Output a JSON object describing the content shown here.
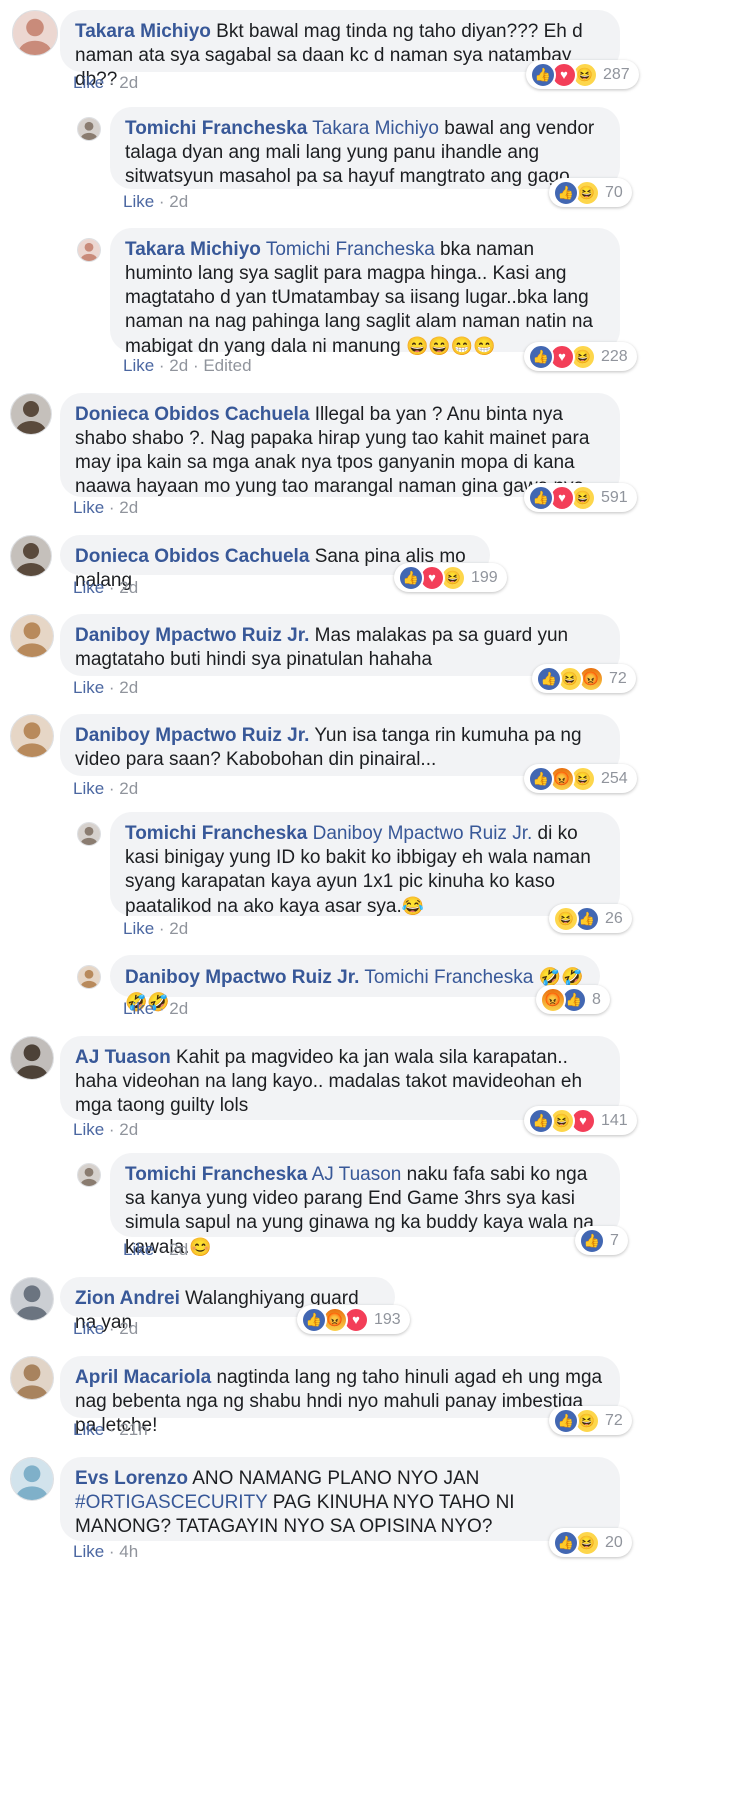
{
  "colors": {
    "link": "#385898",
    "bubble": "#f2f3f5",
    "meta": "#90949c",
    "like_reaction": "#4267b2",
    "love_reaction": "#f33e58",
    "haha_reaction": "#fdd64b"
  },
  "comments": [
    {
      "author": "Takara Michiyo",
      "text": "Bkt bawal mag tinda ng taho diyan??? Eh d naman ata sya sagabal sa daan kc d naman sya natambay db??",
      "like_label": "Like",
      "time": "2d",
      "reactions": [
        "like-icon",
        "love-icon",
        "haha-icon"
      ],
      "reaction_count": "287",
      "avatar_color": "#c98b7a"
    },
    {
      "author": "Tomichi Francheska",
      "mention": "Takara Michiyo",
      "text": "bawal ang vendor talaga dyan ang mali lang yung panu ihandle ang sitwatsyun masahol pa sa hayuf mangtrato ang gago.",
      "like_label": "Like",
      "time": "2d",
      "reactions": [
        "like-icon",
        "haha-icon"
      ],
      "reaction_count": "70",
      "avatar_color": "#8a7c70"
    },
    {
      "author": "Takara Michiyo",
      "mention": "Tomichi Francheska",
      "text": "bka naman huminto lang sya saglit para magpa hinga.. Kasi ang magtataho d yan tUmatambay sa iisang lugar..bka lang naman na nag pahinga lang saglit alam naman natin na mabigat dn yang dala ni manung",
      "emoji": "😄😄😁😁",
      "like_label": "Like",
      "time": "2d",
      "edited": "Edited",
      "reactions": [
        "like-icon",
        "love-icon",
        "haha-icon"
      ],
      "reaction_count": "228",
      "avatar_color": "#c98b7a"
    },
    {
      "author": "Donieca Obidos Cachuela",
      "text": "Illegal ba yan ? Anu binta nya shabo shabo ?. Nag papaka hirap yung tao kahit mainet para may ipa kain sa mga anak nya tpos ganyanin mopa di kana naawa hayaan mo yung tao marangal naman gina gawa nya .",
      "like_label": "Like",
      "time": "2d",
      "reactions": [
        "like-icon",
        "love-icon",
        "haha-icon"
      ],
      "reaction_count": "591",
      "avatar_color": "#5a4a3c"
    },
    {
      "author": "Donieca Obidos Cachuela",
      "text": "Sana pina alis mo nalang",
      "like_label": "Like",
      "time": "2d",
      "reactions": [
        "like-icon",
        "love-icon",
        "haha-icon"
      ],
      "reaction_count": "199",
      "avatar_color": "#5a4a3c"
    },
    {
      "author": "Daniboy Mpactwo Ruiz Jr.",
      "text": "Mas malakas pa sa guard yun magtataho buti hindi sya pinatulan hahaha",
      "like_label": "Like",
      "time": "2d",
      "reactions": [
        "like-icon",
        "haha-icon",
        "angry-icon"
      ],
      "reaction_count": "72",
      "avatar_color": "#b88a5c"
    },
    {
      "author": "Daniboy Mpactwo Ruiz Jr.",
      "text": "Yun isa tanga rin kumuha pa ng video para saan? Kabobohan din pinairal...",
      "like_label": "Like",
      "time": "2d",
      "reactions": [
        "like-icon",
        "angry-icon",
        "haha-icon"
      ],
      "reaction_count": "254",
      "avatar_color": "#b88a5c"
    },
    {
      "author": "Tomichi Francheska",
      "mention": "Daniboy Mpactwo Ruiz Jr.",
      "text": "di ko kasi binigay yung ID ko bakit ko ibbigay eh wala naman syang karapatan kaya ayun 1x1 pic kinuha ko kaso paatalikod na ako kaya asar sya.",
      "emoji": "😂",
      "like_label": "Like",
      "time": "2d",
      "reactions": [
        "haha-icon",
        "like-icon"
      ],
      "reaction_count": "26",
      "avatar_color": "#8a7c70"
    },
    {
      "author": "Daniboy Mpactwo Ruiz Jr.",
      "mention": "Tomichi Francheska",
      "text": "",
      "emoji": "🤣🤣🤣🤣",
      "like_label": "Like",
      "time": "2d",
      "reactions": [
        "angry-icon",
        "like-icon"
      ],
      "reaction_count": "8",
      "avatar_color": "#b88a5c"
    },
    {
      "author": "AJ Tuason",
      "text": "Kahit pa magvideo ka jan wala sila karapatan.. haha videohan na lang kayo.. madalas takot mavideohan eh mga taong guilty lols",
      "like_label": "Like",
      "time": "2d",
      "reactions": [
        "like-icon",
        "haha-icon",
        "love-icon"
      ],
      "reaction_count": "141",
      "avatar_color": "#4d4238"
    },
    {
      "author": "Tomichi Francheska",
      "mention": "AJ Tuason",
      "text": "naku fafa sabi ko nga sa kanya yung video parang End Game 3hrs sya kasi simula sapul na yung ginawa ng ka buddy kaya wala na kawala.",
      "emoji": "😊",
      "like_label": "Like",
      "time": "2d",
      "reactions": [
        "like-icon"
      ],
      "reaction_count": "7",
      "avatar_color": "#8a7c70"
    },
    {
      "author": "Zion Andrei",
      "text": "Walanghiyang guard na yan",
      "like_label": "Like",
      "time": "2d",
      "reactions": [
        "like-icon",
        "angry-icon",
        "love-icon"
      ],
      "reaction_count": "193",
      "avatar_color": "#6b7480"
    },
    {
      "author": "April Macariola",
      "text": "nagtinda lang ng taho hinuli agad eh ung mga nag bebenta nga ng shabu hndi nyo mahuli panay imbestiga pa letche!",
      "like_label": "Like",
      "time": "21h",
      "reactions": [
        "like-icon",
        "haha-icon"
      ],
      "reaction_count": "72",
      "avatar_color": "#a8835e"
    },
    {
      "author": "Evs Lorenzo",
      "text": "ANO NAMANG PLANO NYO JAN",
      "hashtag": "#ORTIGASCECURITY",
      "text2": "PAG KINUHA NYO TAHO NI MANONG? TATAGAYIN NYO SA OPISINA NYO?",
      "like_label": "Like",
      "time": "4h",
      "reactions": [
        "like-icon",
        "haha-icon"
      ],
      "reaction_count": "20",
      "avatar_color": "#7fb0c9"
    }
  ]
}
